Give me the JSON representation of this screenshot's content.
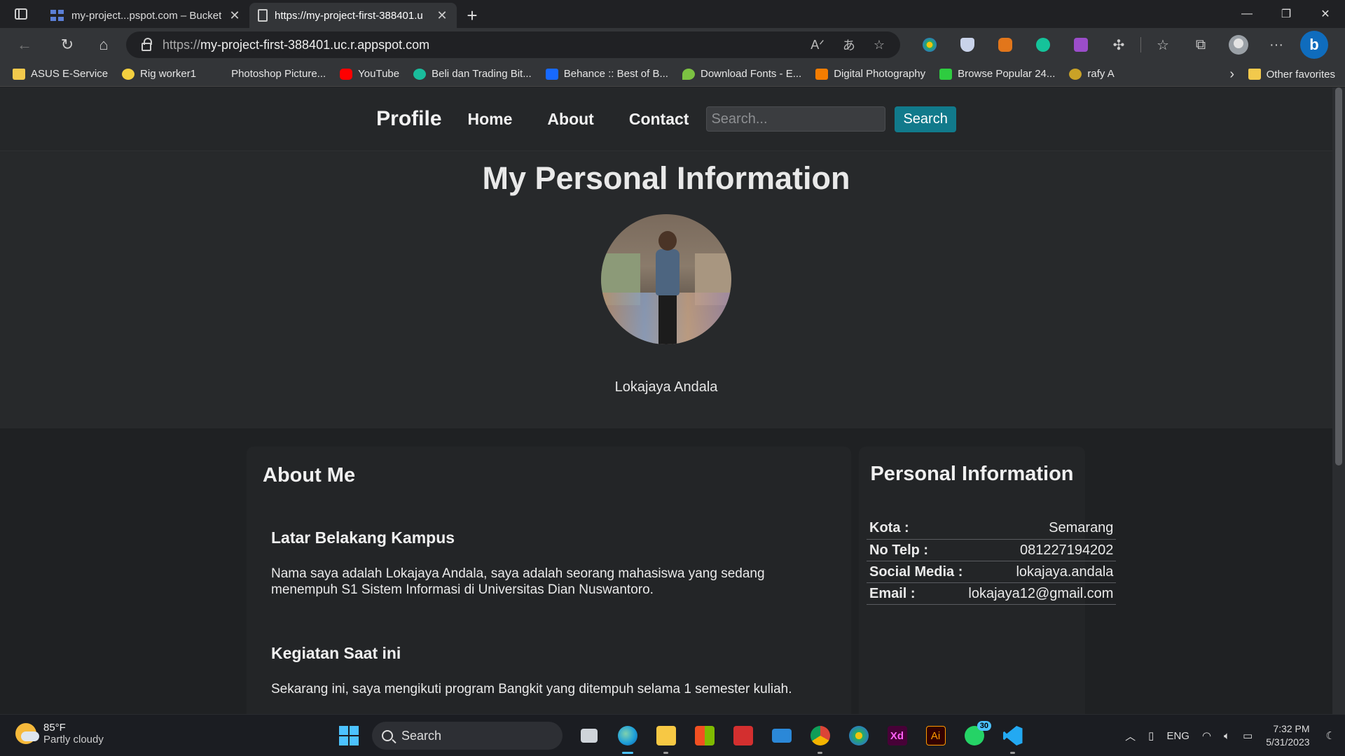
{
  "browser": {
    "tabs": [
      {
        "title": "my-project...pspot.com – Bucket",
        "active": false
      },
      {
        "title": "https://my-project-first-388401.u",
        "active": true
      }
    ],
    "url_prefix": "https://",
    "url_host": "my-project-first-388401.uc.r.appspot.com",
    "bookmarks": [
      {
        "label": "ASUS E-Service",
        "icon": "folder-icon"
      },
      {
        "label": "Rig worker1",
        "icon": "rig-icon"
      },
      {
        "label": "Photoshop Picture...",
        "icon": "none"
      },
      {
        "label": "YouTube",
        "icon": "youtube-icon"
      },
      {
        "label": "Beli dan Trading Bit...",
        "icon": "crypto-icon"
      },
      {
        "label": "Behance :: Best of B...",
        "icon": "behance-icon"
      },
      {
        "label": "Download Fonts - E...",
        "icon": "fonts-icon"
      },
      {
        "label": "Digital Photography",
        "icon": "blogger-icon"
      },
      {
        "label": "Browse Popular 24...",
        "icon": "browse-icon"
      },
      {
        "label": "rafy A",
        "icon": "rafy-icon"
      }
    ],
    "other_favorites": "Other favorites"
  },
  "nav": {
    "brand": "Profile",
    "links": [
      "Home",
      "About",
      "Contact"
    ],
    "search_placeholder": "Search...",
    "search_button": "Search"
  },
  "hero": {
    "title": "My Personal Information",
    "name": "Lokajaya Andala"
  },
  "about": {
    "heading": "About Me",
    "sections": [
      {
        "title": "Latar Belakang Kampus",
        "text": "Nama saya adalah Lokajaya Andala, saya adalah seorang mahasiswa yang sedang menempuh S1 Sistem Informasi di Universitas Dian Nuswantoro."
      },
      {
        "title": "Kegiatan Saat ini",
        "text": "Sekarang ini, saya mengikuti program Bangkit yang ditempuh selama 1 semester kuliah."
      }
    ]
  },
  "personal_info": {
    "heading": "Personal Information",
    "rows": [
      {
        "key": "Kota :",
        "value": "Semarang"
      },
      {
        "key": "No Telp :",
        "value": "081227194202"
      },
      {
        "key": "Social Media :",
        "value": "lokajaya.andala"
      },
      {
        "key": "Email :",
        "value": "lokajaya12@gmail.com"
      }
    ]
  },
  "taskbar": {
    "temp": "85°F",
    "weather": "Partly cloudy",
    "search_label": "Search",
    "whatsapp_badge": "30",
    "lang": "ENG",
    "time": "7:32 PM",
    "date": "5/31/2023"
  },
  "colors": {
    "accent_button": "#117a8b",
    "page_bg": "#1f2123",
    "card_bg": "#232527"
  }
}
